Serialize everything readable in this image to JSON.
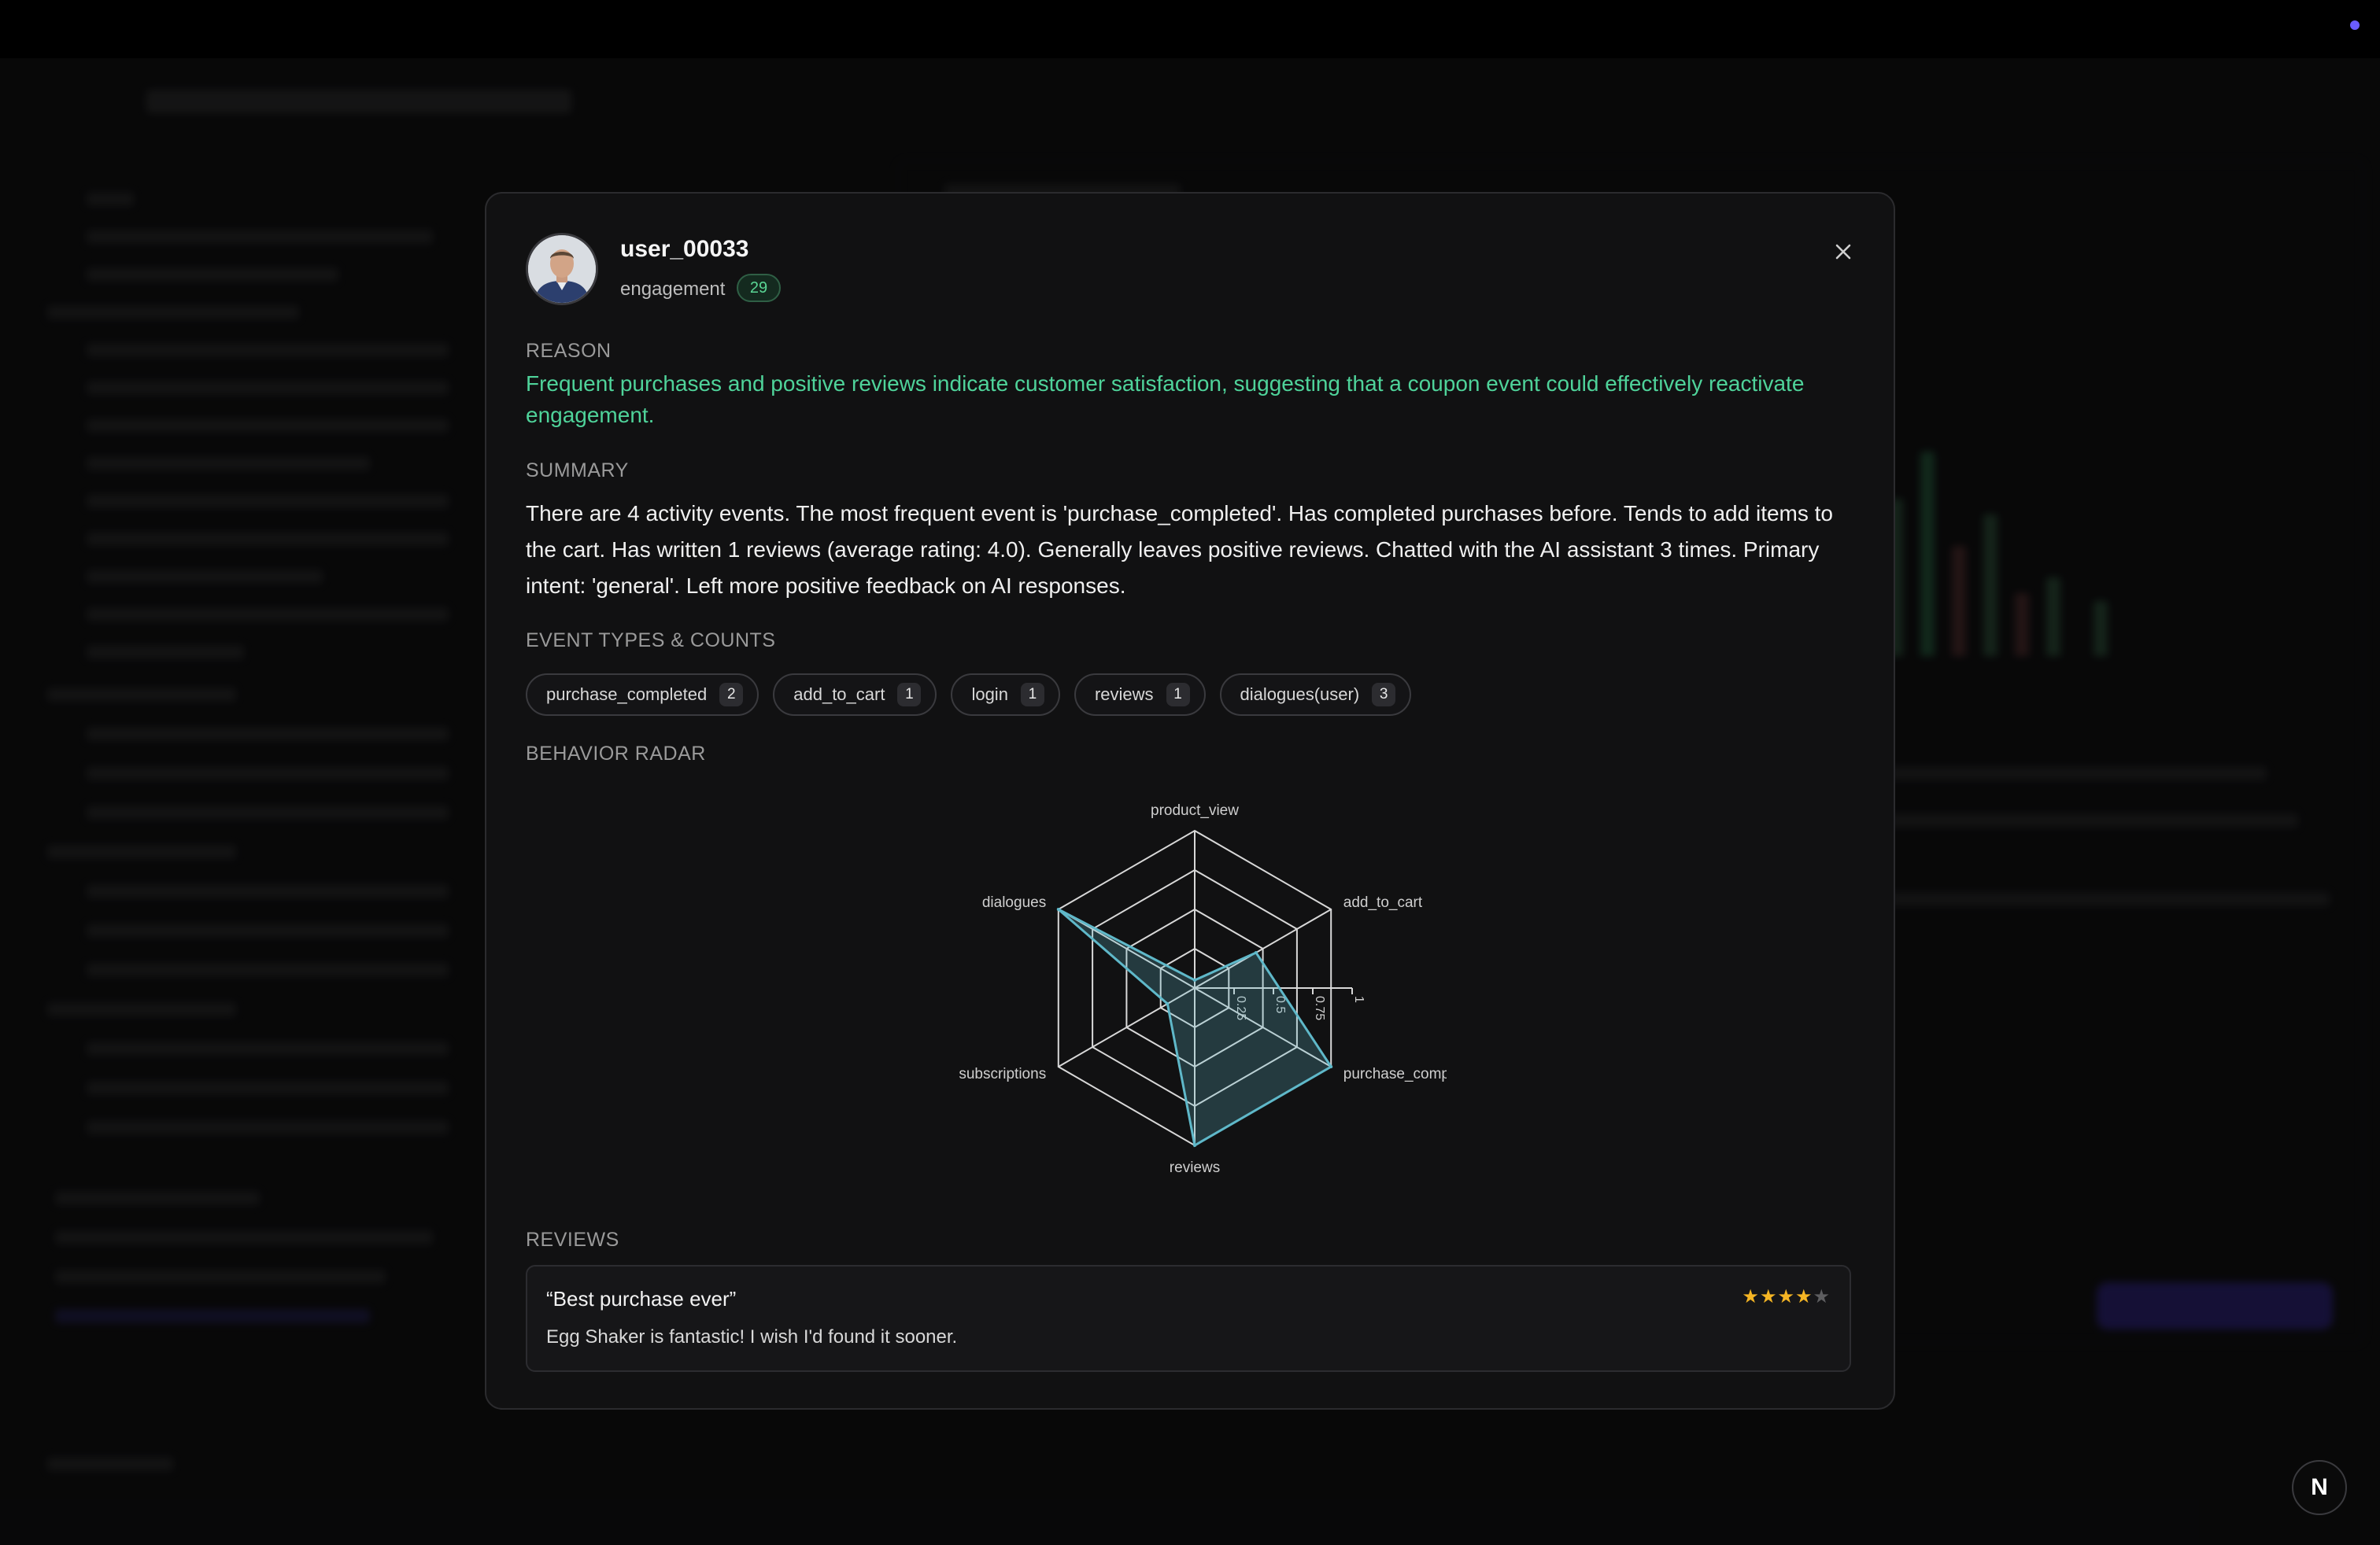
{
  "modal": {
    "username": "user_00033",
    "engagement_label": "engagement",
    "engagement_value": "29",
    "reason_title": "REASON",
    "reason_text": "Frequent purchases and positive reviews indicate customer satisfaction, suggesting that a coupon event could effectively reactivate engagement.",
    "summary_title": "SUMMARY",
    "summary_text": "There are 4 activity events. The most frequent event is 'purchase_completed'. Has completed purchases before. Tends to add items to the cart.  Has written 1 reviews (average rating: 4.0). Generally leaves positive reviews.  Chatted with the AI assistant 3 times. Primary intent: 'general'. Left more positive feedback on AI responses.",
    "events_title": "EVENT TYPES & COUNTS",
    "events": [
      {
        "label": "purchase_completed",
        "count": "2"
      },
      {
        "label": "add_to_cart",
        "count": "1"
      },
      {
        "label": "login",
        "count": "1"
      },
      {
        "label": "reviews",
        "count": "1"
      },
      {
        "label": "dialogues(user)",
        "count": "3"
      }
    ],
    "radar_title": "BEHAVIOR RADAR",
    "reviews_title": "REVIEWS",
    "review": {
      "title": "“Best purchase ever”",
      "body": "Egg Shaker is fantastic! I wish I'd found it sooner.",
      "rating": 4,
      "max_rating": 5
    },
    "close_icon": "close-icon"
  },
  "chart_data": {
    "type": "radar",
    "axes": [
      "product_view",
      "add_to_cart",
      "purchase_completed",
      "reviews",
      "subscriptions",
      "dialogues"
    ],
    "values": [
      0.05,
      0.45,
      1.0,
      1.0,
      0.2,
      1.0
    ],
    "ticks": [
      "0.25",
      "0.5",
      "0.75",
      "1"
    ],
    "rlim": [
      0,
      1
    ],
    "series_color": "#5fb8c9"
  },
  "colors": {
    "accent_green": "#4fd39a",
    "star": "#f5b524",
    "nextjs_dot": "#6a5cff"
  },
  "nextjs_badge": "N"
}
